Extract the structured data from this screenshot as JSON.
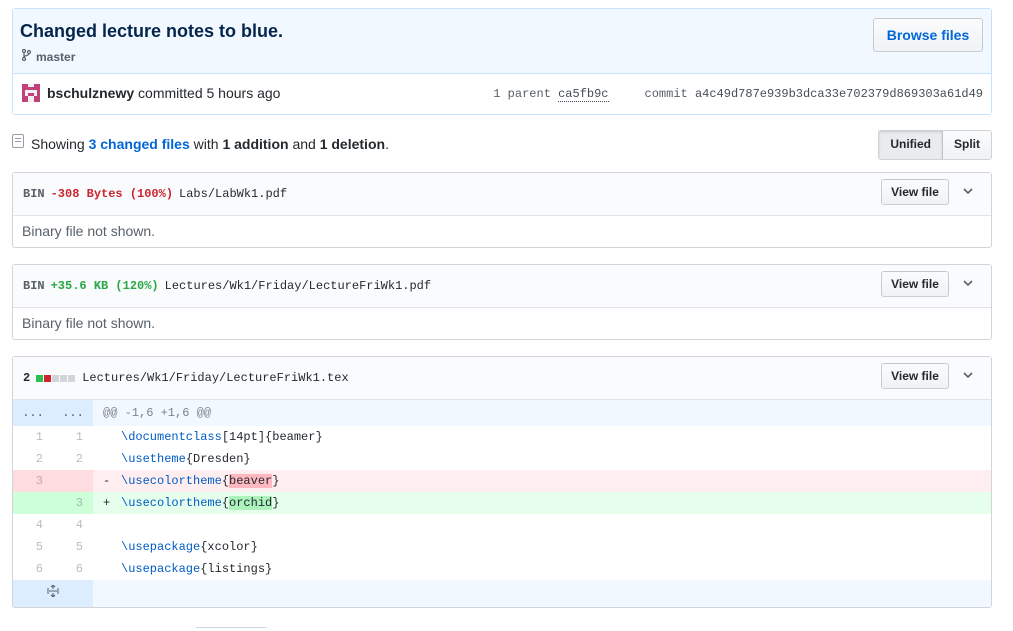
{
  "commit": {
    "title": "Changed lecture notes to blue.",
    "branch": "master",
    "browse_label": "Browse files",
    "author": "bschulznewy",
    "action": "committed",
    "time": "5 hours ago",
    "parent_label": "1 parent",
    "parent_sha": "ca5fb9c",
    "commit_label": "commit",
    "commit_sha": "a4c49d787e939b3dca33e702379d869303a61d49"
  },
  "toc": {
    "showing": "Showing",
    "changed_files": "3 changed files",
    "with": "with",
    "additions": "1 addition",
    "and": "and",
    "deletions": "1 deletion",
    "period": ".",
    "unified_label": "Unified",
    "split_label": "Split"
  },
  "files": [
    {
      "type": "BIN",
      "change": "-308 Bytes (100%)",
      "path": "Labs/LabWk1.pdf",
      "view_label": "View file",
      "body": "Binary file not shown."
    },
    {
      "type": "BIN",
      "change": "+35.6 KB (120%)",
      "path": "Lectures/Wk1/Friday/LectureFriWk1.pdf",
      "view_label": "View file",
      "body": "Binary file not shown."
    },
    {
      "count": "2",
      "path": "Lectures/Wk1/Friday/LectureFriWk1.tex",
      "view_label": "View file",
      "hunk_left": "...",
      "hunk_right": "...",
      "hunk": "@@ -1,6 +1,6 @@",
      "lines": [
        {
          "old": "1",
          "new": "1",
          "sign": "",
          "cmd": "\\documentclass",
          "arg": "[14pt]{beamer}"
        },
        {
          "old": "2",
          "new": "2",
          "sign": "",
          "cmd": "\\usetheme",
          "arg": "{Dresden}"
        },
        {
          "old": "3",
          "new": "",
          "sign": "-",
          "cmd": "\\usecolortheme",
          "pre": "{",
          "hl": "beaver",
          "post": "}"
        },
        {
          "old": "",
          "new": "3",
          "sign": "+",
          "cmd": "\\usecolortheme",
          "pre": "{",
          "hl": "orchid",
          "post": "}"
        },
        {
          "old": "4",
          "new": "4",
          "sign": "",
          "cmd": "",
          "arg": ""
        },
        {
          "old": "5",
          "new": "5",
          "sign": "",
          "cmd": "\\usepackage",
          "arg": "{xcolor}"
        },
        {
          "old": "6",
          "new": "6",
          "sign": "",
          "cmd": "\\usepackage",
          "arg": "{listings}"
        }
      ]
    }
  ],
  "colors": {
    "add": "#28a745",
    "del": "#cb2431",
    "link": "#0366d6"
  }
}
